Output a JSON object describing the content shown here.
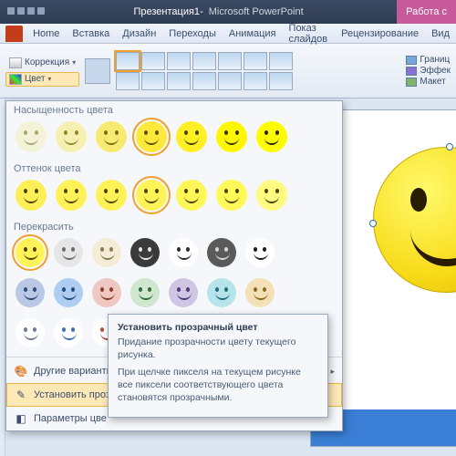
{
  "titlebar": {
    "document": "Презентация1",
    "sep": " - ",
    "app": "Microsoft PowerPoint"
  },
  "contextual_tab": "Работа с",
  "tabs": [
    "Home",
    "Вставка",
    "Дизайн",
    "Переходы",
    "Анимация",
    "Показ слайдов",
    "Рецензирование",
    "Вид"
  ],
  "ribbon": {
    "correction": "Коррекция",
    "color": "Цвет",
    "border": "Границ",
    "effects": "Эффек",
    "layout": "Макет"
  },
  "panel": {
    "saturation_label": "Насыщенность цвета",
    "tone_label": "Оттенок цвета",
    "recolor_label": "Перекрасить",
    "saturation": [
      {
        "bg": "#f3f3d8",
        "fg": "#a8a878"
      },
      {
        "bg": "#f5f0b0",
        "fg": "#8f8730"
      },
      {
        "bg": "#f8ea70",
        "fg": "#7a6f10"
      },
      {
        "bg": "#fde93a",
        "fg": "#5a5000",
        "sel": true
      },
      {
        "bg": "#fff026",
        "fg": "#4a4200"
      },
      {
        "bg": "#fff700",
        "fg": "#3a3400"
      },
      {
        "bg": "#fffb00",
        "fg": "#2a2600"
      }
    ],
    "tone": [
      {
        "bg": "#ffef57",
        "fg": "#4a4200"
      },
      {
        "bg": "#fff157",
        "fg": "#4a4200"
      },
      {
        "bg": "#fff257",
        "fg": "#4a4200"
      },
      {
        "bg": "#fff357",
        "fg": "#4a4200",
        "sel": true
      },
      {
        "bg": "#fff757",
        "fg": "#4a4200"
      },
      {
        "bg": "#fff957",
        "fg": "#4a4200"
      },
      {
        "bg": "#fffb80",
        "fg": "#4a4200"
      }
    ],
    "recolor_rows": [
      [
        {
          "bg": "#fff357",
          "fg": "#4a4200",
          "sel": true
        },
        {
          "bg": "#e6e6e6",
          "fg": "#6b6b6b"
        },
        {
          "bg": "#f4ecd6",
          "fg": "#8a7a4a"
        },
        {
          "bg": "#3a3a3a",
          "fg": "#e8e8e8"
        },
        {
          "bg": "#ffffff",
          "fg": "#2a2a2a"
        },
        {
          "bg": "#5a5a5a",
          "fg": "#d8d8d8"
        },
        {
          "bg": "#ffffff",
          "fg": "#1a1a1a"
        }
      ],
      [
        {
          "bg": "#b9c8e4",
          "fg": "#2e4a7a"
        },
        {
          "bg": "#aecdf0",
          "fg": "#1e4a80"
        },
        {
          "bg": "#f0c8c2",
          "fg": "#8a3a30"
        },
        {
          "bg": "#cfe6cf",
          "fg": "#2e6a3a"
        },
        {
          "bg": "#cfc6e4",
          "fg": "#4a3a7a"
        },
        {
          "bg": "#b6e4ea",
          "fg": "#1e6a7a"
        },
        {
          "bg": "#f4e0b6",
          "fg": "#8a6a20"
        }
      ],
      [
        {
          "bg": "#ffffff",
          "fg": "#6b7a93"
        },
        {
          "bg": "#ffffff",
          "fg": "#3a6fb0"
        },
        {
          "bg": "#ffffff",
          "fg": "#b04a3a"
        },
        {
          "bg": "#ffffff",
          "fg": "#3a8a4a"
        },
        {
          "bg": "#ffffff",
          "fg": "#6a4aa0"
        },
        {
          "bg": "#ffffff",
          "fg": "#2a8a9a"
        },
        {
          "bg": "#ffffff",
          "fg": "#b08a2a"
        }
      ]
    ],
    "more_variants": "Другие варианты",
    "set_transparent": "Установить прозрачный цвет",
    "color_params": "Параметры цве"
  },
  "tooltip": {
    "title": "Установить прозрачный цвет",
    "p1": "Придание прозрачности цвету текущего рисунка.",
    "p2": "При щелчке пикселя на текущем рисунке все пиксели соответствующего цвета становятся прозрачными."
  }
}
